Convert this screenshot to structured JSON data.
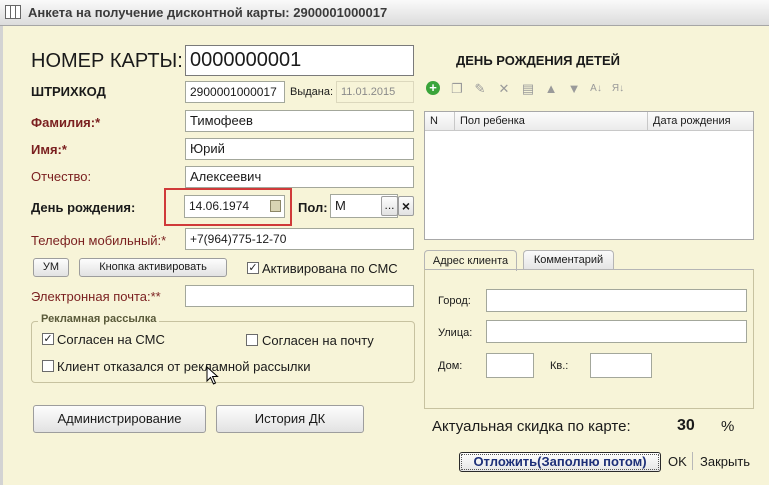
{
  "window": {
    "title": "Анкета на получение дисконтной карты: 2900001000017"
  },
  "form": {
    "card_number_label": "НОМЕР КАРТЫ:",
    "card_number_value": "0000000001",
    "barcode_label": "ШТРИХКОД",
    "barcode_value": "2900001000017",
    "issued_label": "Выдана:",
    "issued_value": "11.01.2015",
    "surname_label": "Фамилия:*",
    "surname_value": "Тимофеев",
    "name_label": "Имя:*",
    "name_value": "Юрий",
    "patronymic_label": "Отчество:",
    "patronymic_value": "Алексеевич",
    "birthday_label": "День рождения:",
    "birthday_value": "14.06.1974",
    "gender_label": "Пол:",
    "gender_value": "М",
    "gender_select_glyph": "...",
    "gender_clear_glyph": "×",
    "phone_label": "Телефон мобильный:*",
    "phone_value": "+7(964)775-12-70",
    "um_button": "УМ",
    "activate_button": "Кнопка активировать",
    "activated_sms_label": "Активирована по СМС",
    "email_label": "Электронная почта:**",
    "email_value": ""
  },
  "mailing": {
    "group_label": "Рекламная рассылка",
    "sms_consent_label": "Согласен на СМС",
    "mail_consent_label": "Согласен на почту",
    "refused_label": "Клиент отказался от рекламной рассылки"
  },
  "checks": {
    "activated_sms": "✓",
    "sms_consent": "✓",
    "mail_consent": "",
    "refused": ""
  },
  "buttons": {
    "admin": "Администрирование",
    "history": "История ДК",
    "postpone": "Отложить(Заполню потом)",
    "ok": "OK",
    "close": "Закрыть"
  },
  "children": {
    "title": "ДЕНЬ РОЖДЕНИЯ ДЕТЕЙ",
    "toolbar_icons": [
      "add-icon",
      "copy-icon",
      "edit-icon",
      "delete-icon",
      "save-icon",
      "move-up-icon",
      "move-down-icon",
      "sort-asc-icon",
      "sort-desc-icon"
    ],
    "columns": [
      "N",
      "Пол ребенка",
      "Дата рождения"
    ],
    "rows": []
  },
  "tabs": {
    "address": "Адрес клиента",
    "comment": "Комментарий"
  },
  "address": {
    "city_label": "Город:",
    "city_value": "",
    "street_label": "Улица:",
    "street_value": "",
    "house_label": "Дом:",
    "house_value": "",
    "apt_label": "Кв.:",
    "apt_value": ""
  },
  "discount": {
    "label": "Актуальная скидка по карте:",
    "value": "30",
    "unit": "%"
  },
  "colors": {
    "background": "#f7f4d8",
    "required_label": "#7a1f1f",
    "highlight_border": "#d03a3a",
    "toolbar_add": "#3aa43a"
  }
}
